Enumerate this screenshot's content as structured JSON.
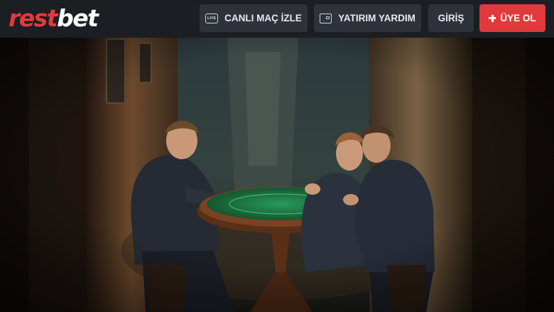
{
  "header": {
    "logo": {
      "part_a": "rest",
      "part_b": "bet"
    },
    "nav": {
      "live_match": {
        "label": "CANLI MAÇ İZLE",
        "icon": "live-tv-icon"
      },
      "deposit_help": {
        "label": "YATIRIM YARDIM",
        "icon": "wallet-icon"
      },
      "login": {
        "label": "GİRİŞ"
      },
      "register": {
        "label": "ÜYE OL",
        "icon": "plus-icon"
      }
    }
  },
  "colors": {
    "header_bg": "#1b1e23",
    "button_bg": "#2e333b",
    "accent_red": "#e13a3d",
    "table_felt": "#1f7a43"
  },
  "hero": {
    "scene": "poker-table-alley"
  }
}
